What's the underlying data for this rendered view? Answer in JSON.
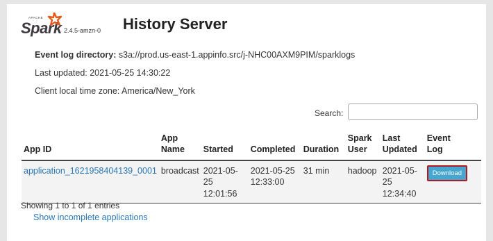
{
  "header": {
    "logo_text": "Spark",
    "logo_small_text": "APACHE",
    "version": "2.4.5-amzn-0",
    "title": "History Server"
  },
  "info": {
    "event_log_label": "Event log directory:",
    "event_log_value": "s3a://prod.us-east-1.appinfo.src/j-NHC00AXM9PIM/sparklogs",
    "last_updated": "Last updated: 2021-05-25 14:30:22",
    "timezone": "Client local time zone: America/New_York"
  },
  "search": {
    "label": "Search:",
    "value": "",
    "placeholder": ""
  },
  "table": {
    "headers": {
      "app_id": "App ID",
      "app_name_1": "App",
      "app_name_2": "Name",
      "started": "Started",
      "completed": "Completed",
      "duration": "Duration",
      "spark_user_1": "Spark",
      "spark_user_2": "User",
      "last_updated_1": "Last",
      "last_updated_2": "Updated",
      "event_log_1": "Event",
      "event_log_2": "Log"
    },
    "rows": [
      {
        "app_id": "application_1621958404139_0001",
        "app_name": "broadcast",
        "started_date": "2021-05-25",
        "started_time": "12:01:56",
        "completed_date": "2021-05-25",
        "completed_time": "12:33:00",
        "duration": "31 min",
        "spark_user": "hadoop",
        "last_updated_date": "2021-05-25",
        "last_updated_time": "12:34:40",
        "download_label": "Download"
      }
    ]
  },
  "footer": {
    "entries": "Showing 1 to 1 of 1 entries",
    "incomplete_link": "Show incomplete applications"
  },
  "colors": {
    "link": "#2a77b6",
    "download_button": "#46a6cf",
    "download_border": "#b5171e",
    "logo_orange": "#e25a1c",
    "logo_dark": "#3c3a3e"
  }
}
